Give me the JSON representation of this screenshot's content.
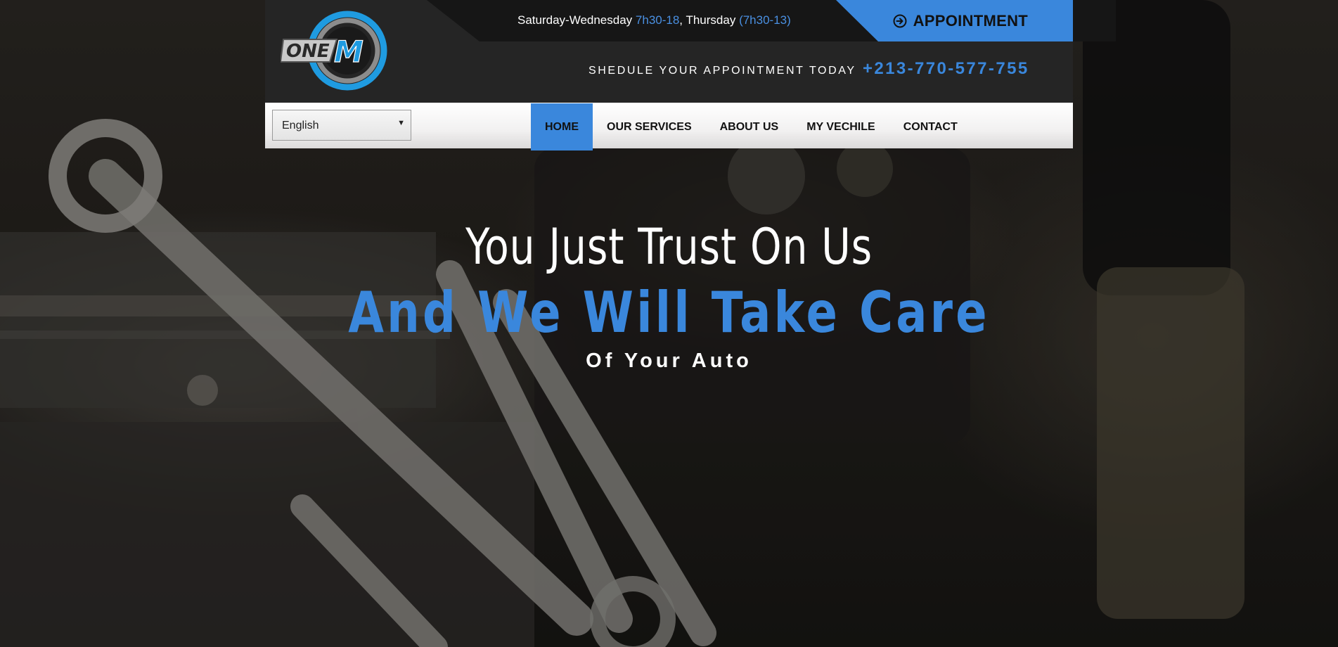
{
  "header": {
    "hours": {
      "days1": "Saturday-Wednesday",
      "time1": "7h30-18",
      "sep": ",",
      "days2": "Thursday",
      "time2": "(7h30-13)"
    },
    "appointment_label": "APPOINTMENT",
    "schedule_text": "SHEDULE YOUR APPOINTMENT TODAY",
    "phone": "+213-770-577-755",
    "logo_text": "ONE M"
  },
  "nav": {
    "language": "English",
    "items": [
      {
        "label": "HOME",
        "active": true
      },
      {
        "label": "OUR SERVICES",
        "active": false
      },
      {
        "label": "ABOUT US",
        "active": false
      },
      {
        "label": "MY VECHILE",
        "active": false
      },
      {
        "label": "CONTACT",
        "active": false
      }
    ]
  },
  "hero": {
    "line1": "You Just Trust On Us",
    "line2": "And We Will Take Care",
    "line3": "Of Your Auto"
  },
  "colors": {
    "accent": "#3a87dc",
    "header_bg": "#252525",
    "nav_bg": "#f2f1f1"
  }
}
